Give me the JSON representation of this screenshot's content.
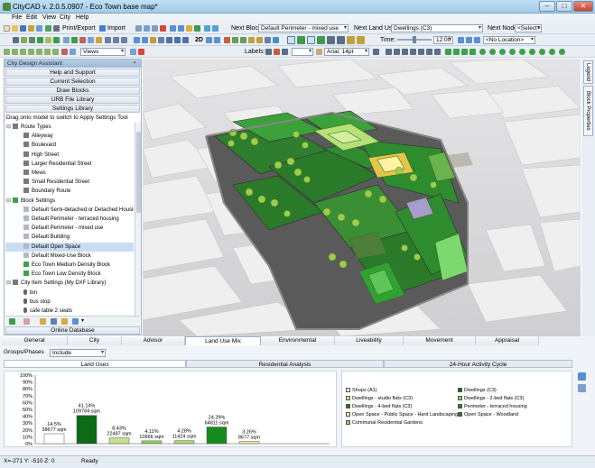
{
  "window": {
    "title": "CityCAD v. 2.0.5.0907 - Eco Town base map*",
    "min": "–",
    "max": "□",
    "close": "✕"
  },
  "menu": [
    "File",
    "Edit",
    "View",
    "City",
    "Help"
  ],
  "toolbar1": {
    "print_export": "Print/Export",
    "import": "Import",
    "next_block_label": "Next Block:",
    "next_block_value": "Default Perimeter - mixed use",
    "next_land_use_label": "Next Land Use:",
    "next_land_use_value": "Dwellings (C3)",
    "next_node_label": "Next Node:",
    "next_node_value": "<Select>"
  },
  "toolbar2": {
    "time_label": "Time:",
    "time_value": "12:00",
    "location_value": "<No Location>",
    "view_2d": "2D"
  },
  "toolbar3": {
    "views_label": "Views",
    "labels_label": "Labels:",
    "font_value": "Arial, 14pt"
  },
  "left_panel": {
    "title": "City Design Assistant",
    "strips": [
      "Help and Support",
      "Current Selection",
      "Draw Blocks",
      "URB File Library",
      "Settings Library"
    ],
    "hint": "Drag onto model to switch to Apply Settings Tool",
    "tree": [
      {
        "text": "Route Types",
        "level": 0,
        "kind": "group"
      },
      {
        "text": "Alleyway",
        "level": 1,
        "kind": "route"
      },
      {
        "text": "Boulevard",
        "level": 1,
        "kind": "route"
      },
      {
        "text": "High Street",
        "level": 1,
        "kind": "route"
      },
      {
        "text": "Larger Residential Street",
        "level": 1,
        "kind": "route"
      },
      {
        "text": "Mews",
        "level": 1,
        "kind": "route"
      },
      {
        "text": "Small Residential Street",
        "level": 1,
        "kind": "route"
      },
      {
        "text": "Boundary Route",
        "level": 1,
        "kind": "route"
      },
      {
        "text": "Block Settings",
        "level": 0,
        "kind": "group-green"
      },
      {
        "text": "Default Semi-detached or Detached Housing",
        "level": 1,
        "kind": "block"
      },
      {
        "text": "Default Perimeter - terraced housing",
        "level": 1,
        "kind": "block"
      },
      {
        "text": "Default Perimeter - mixed use",
        "level": 1,
        "kind": "block"
      },
      {
        "text": "Default Building",
        "level": 1,
        "kind": "block"
      },
      {
        "text": "Default Open Space",
        "level": 1,
        "kind": "block",
        "selected": true
      },
      {
        "text": "Default Mixed-Use Block",
        "level": 1,
        "kind": "block"
      },
      {
        "text": "Eco Town Medium Density Block",
        "level": 1,
        "kind": "block-green"
      },
      {
        "text": "Eco Town Low Density Block",
        "level": 1,
        "kind": "block-green"
      },
      {
        "text": "City Item Settings (My DXF Library)",
        "level": 0,
        "kind": "group-item"
      },
      {
        "text": "bin",
        "level": 1,
        "kind": "item"
      },
      {
        "text": "bus stop",
        "level": 1,
        "kind": "item"
      },
      {
        "text": "cafe table 2 seats",
        "level": 1,
        "kind": "item"
      },
      {
        "text": "cafe table 4 seats",
        "level": 1,
        "kind": "item"
      },
      {
        "text": "post box",
        "level": 1,
        "kind": "item"
      }
    ],
    "online_db": "Online Database"
  },
  "right_tabs": [
    "Legend",
    "Block Properties"
  ],
  "bottom": {
    "tabs": [
      "General",
      "City",
      "Advisor",
      "Land Use Mix",
      "Environmental",
      "Liveability",
      "Movement",
      "Appraisal"
    ],
    "active_tab": "Land Use Mix",
    "groups_label": "Groups/Phases",
    "groups_value": "Include",
    "subtabs": [
      "Land Uses",
      "Residential Analysis",
      "24-Hour Activity Cycle"
    ]
  },
  "chart_data": {
    "type": "bar",
    "ylim": [
      0,
      100
    ],
    "yticks": [
      "100%",
      "90%",
      "80%",
      "70%",
      "60%",
      "50%",
      "40%",
      "30%",
      "20%",
      "10%",
      "0%"
    ],
    "bars": [
      {
        "pct": 14.5,
        "label1": "14.5%",
        "label2": "38677 sqm",
        "color": "#ffffff"
      },
      {
        "pct": 41.14,
        "label1": "41.14%",
        "label2": "109784 sqm",
        "color": "#0c6b14"
      },
      {
        "pct": 8.43,
        "label1": "8.43%",
        "label2": "22487 sqm",
        "color": "#c6e08a"
      },
      {
        "pct": 4.11,
        "label1": "4.11%",
        "label2": "10966 sqm",
        "color": "#8ccf5a"
      },
      {
        "pct": 4.28,
        "label1": "4.28%",
        "label2": "11424 sqm",
        "color": "#a9d86e"
      },
      {
        "pct": 24.29,
        "label1": "24.29%",
        "label2": "64811 sqm",
        "color": "#168a1e"
      },
      {
        "pct": 3.26,
        "label1": "3.26%",
        "label2": "8677 sqm",
        "color": "#f3e6a0"
      }
    ]
  },
  "legend": [
    {
      "label": "Shops (A1)",
      "color": "#ffffff"
    },
    {
      "label": "Dwellings (C3)",
      "color": "#0c6b14"
    },
    {
      "label": "Dwellings - studio flats (C3)",
      "color": "#c6e08a"
    },
    {
      "label": "Dwellings - 2-bed flats (C3)",
      "color": "#8ccf5a"
    },
    {
      "label": "Dwellings - 4-bed flats (C3)",
      "color": "#2f6f12"
    },
    {
      "label": "Perimeter - terraced housing",
      "color": "#168a1e"
    },
    {
      "label": "Open Space - Public Space - Hard Landscaping",
      "color": "#f3e6a0"
    },
    {
      "label": "Open Space - Woodland",
      "color": "#1f7a24"
    },
    {
      "label": "Communal Residential Gardens",
      "color": "#7fd36a"
    }
  ],
  "status": {
    "coords": "X=-271  Y: -510  Z: 0",
    "ready": "Ready"
  }
}
